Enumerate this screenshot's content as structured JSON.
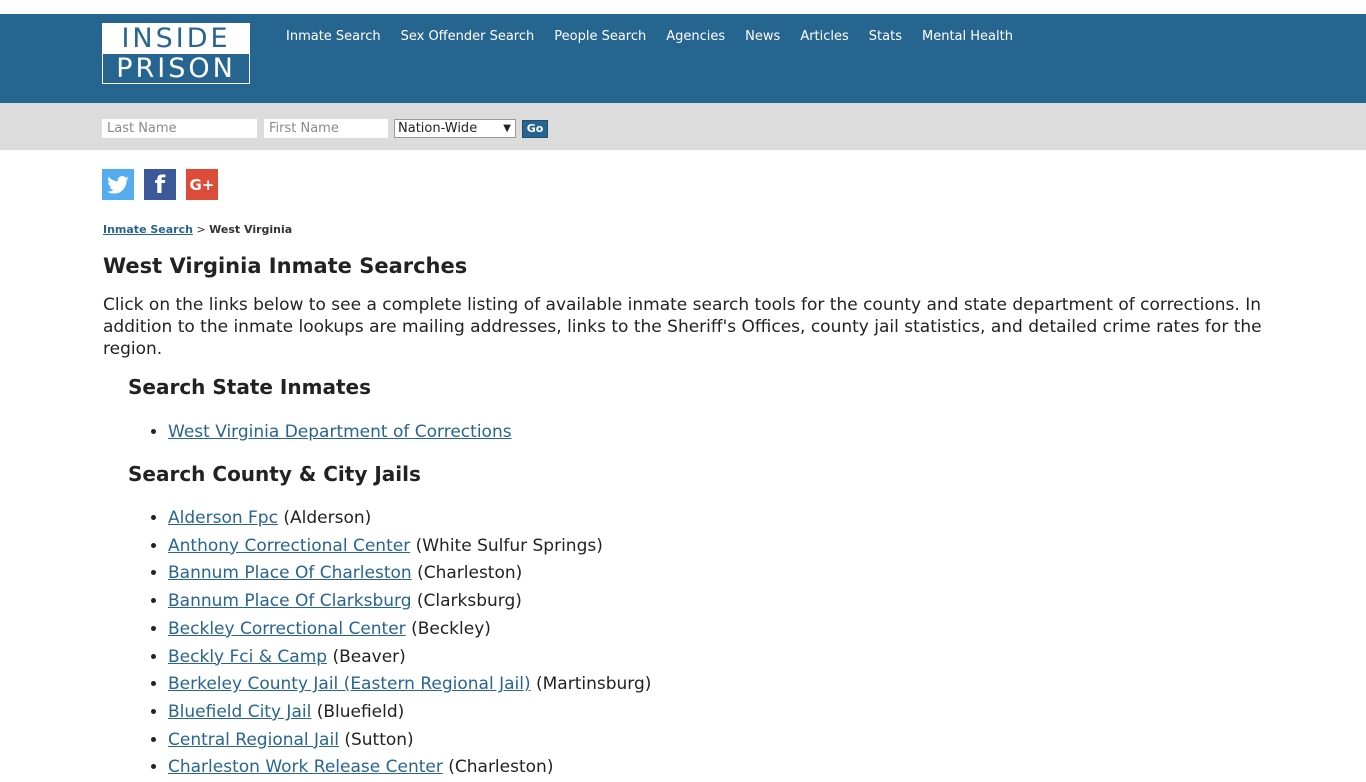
{
  "header": {
    "logo_top": "INSIDE",
    "logo_bottom": "PRISON",
    "nav": [
      "Inmate Search",
      "Sex Offender Search",
      "People Search",
      "Agencies",
      "News",
      "Articles",
      "Stats",
      "Mental Health"
    ]
  },
  "search": {
    "last_placeholder": "Last Name",
    "first_placeholder": "First Name",
    "scope_selected": "Nation-Wide",
    "go_label": "Go"
  },
  "social": {
    "twitter_glyph": "t",
    "facebook_glyph": "f",
    "google_glyph": "G+"
  },
  "breadcrumb": {
    "parent": "Inmate Search",
    "separator": ">",
    "current": "West Virginia"
  },
  "page": {
    "title": "West Virginia Inmate Searches",
    "intro": "Click on the links below to see a complete listing of available inmate search tools for the county and state department of corrections. In addition to the inmate lookups are mailing addresses, links to the Sheriff's Offices, county jail statistics, and detailed crime rates for the region."
  },
  "state_section": {
    "heading": "Search State Inmates",
    "items": [
      {
        "name": "West Virginia Department of Corrections",
        "city": ""
      }
    ]
  },
  "county_section": {
    "heading": "Search County & City Jails",
    "items": [
      {
        "name": "Alderson Fpc",
        "city": "(Alderson)"
      },
      {
        "name": "Anthony Correctional Center",
        "city": "(White Sulfur Springs)"
      },
      {
        "name": "Bannum Place Of Charleston",
        "city": "(Charleston)"
      },
      {
        "name": "Bannum Place Of Clarksburg",
        "city": "(Clarksburg)"
      },
      {
        "name": "Beckley Correctional Center",
        "city": "(Beckley)"
      },
      {
        "name": "Beckly Fci & Camp",
        "city": "(Beaver)"
      },
      {
        "name": "Berkeley County Jail (Eastern Regional Jail)",
        "city": "(Martinsburg)"
      },
      {
        "name": "Bluefield City Jail",
        "city": "(Bluefield)"
      },
      {
        "name": "Central Regional Jail",
        "city": "(Sutton)"
      },
      {
        "name": "Charleston Work Release Center",
        "city": "(Charleston)"
      }
    ]
  }
}
